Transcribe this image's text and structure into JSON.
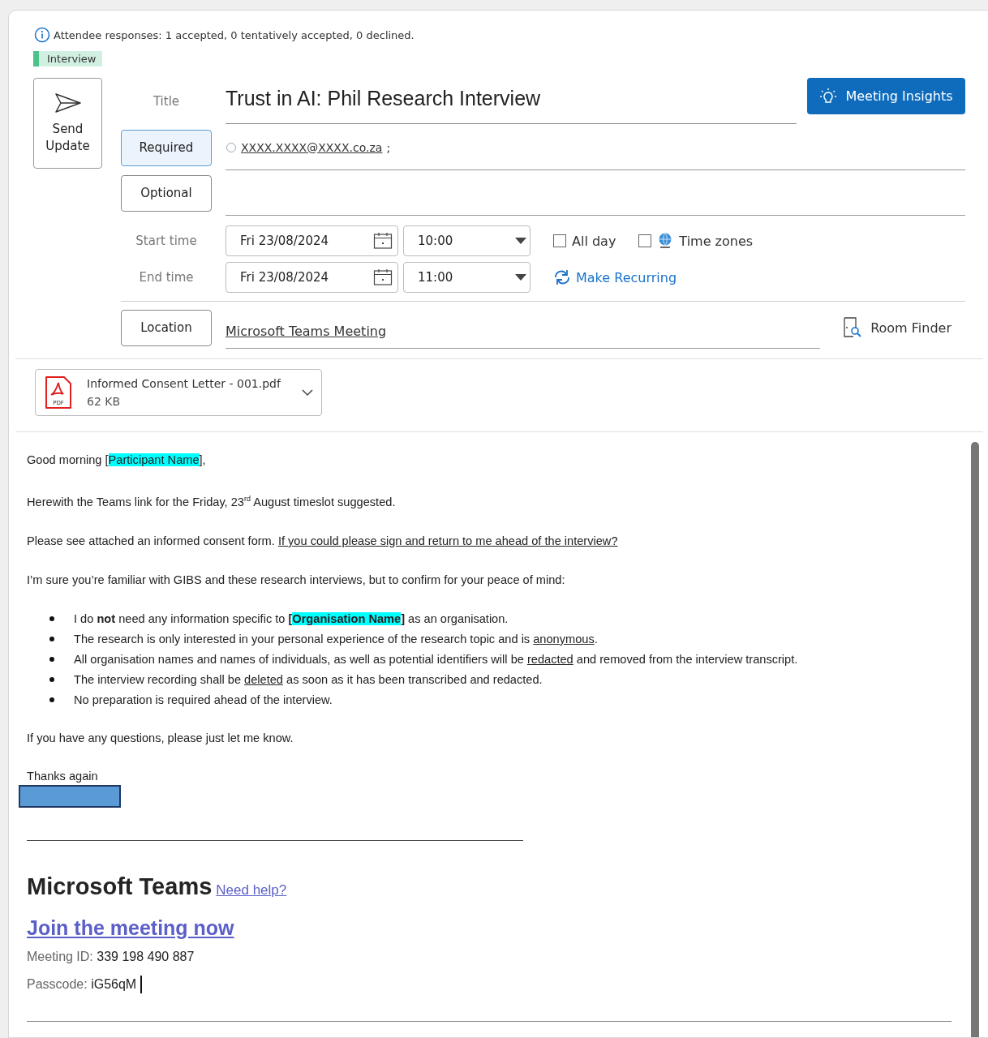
{
  "info_bar": {
    "text": "Attendee responses: 1 accepted, 0 tentatively accepted, 0 declined."
  },
  "category": {
    "label": "Interview",
    "color": "#4cc38a"
  },
  "send_button": {
    "label": "Send Update"
  },
  "insights_button": {
    "label": "Meeting Insights"
  },
  "title": {
    "label": "Title",
    "value": "Trust in AI: Phil Research Interview"
  },
  "required": {
    "label": "Required",
    "selected": true,
    "attendees": [
      {
        "address": "XXXX.XXXX@XXXX.co.za",
        "separator": ";"
      }
    ]
  },
  "optional": {
    "label": "Optional",
    "selected": false
  },
  "times": [
    {
      "label": "Start time",
      "date": "Fri 23/08/2024",
      "time": "10:00"
    },
    {
      "label": "End time",
      "date": "Fri 23/08/2024",
      "time": "11:00"
    }
  ],
  "all_day": {
    "label": "All day",
    "checked": false
  },
  "time_zones": {
    "label": "Time zones",
    "checked": false
  },
  "recurring": {
    "label": "Make Recurring"
  },
  "location": {
    "button": "Location",
    "value": "Microsoft Teams Meeting",
    "room_finder": "Room Finder"
  },
  "attachments": [
    {
      "name": "Informed Consent Letter - 001.pdf",
      "size": "62 KB",
      "file_type": "PDF"
    }
  ],
  "body": [
    {
      "kind": "paragraph",
      "runs": [
        {
          "text": "Good morning ["
        },
        {
          "text": "Participant Name",
          "highlight": true
        },
        {
          "text": "],"
        }
      ]
    },
    {
      "kind": "paragraph",
      "runs": [
        {
          "text": "Herewith the Teams link for the Friday, 23$^{rd}$ August timeslot suggested."
        }
      ]
    },
    {
      "kind": "paragraph",
      "runs": [
        {
          "text": "Please see attached an informed consent form. "
        },
        {
          "text": "If you could please sign and return to me ahead of the interview?",
          "underline": true
        }
      ]
    },
    {
      "kind": "paragraph",
      "runs": [
        {
          "text": "I’m sure you’re familiar with GIBS and these research interviews, but to confirm for your peace of mind:"
        }
      ]
    },
    {
      "kind": "list",
      "items": [
        {
          "runs": [
            {
              "text": "I do **not** need any information specific to **[**"
            },
            {
              "text": "**Organisation Name**",
              "highlight": true
            },
            {
              "text": "**]** as an organisation."
            }
          ]
        },
        {
          "runs": [
            {
              "text": "The research is only interested in your personal experience of the research topic and is "
            },
            {
              "text": "anonymous",
              "underline": true
            },
            {
              "text": "."
            }
          ]
        },
        {
          "runs": [
            {
              "text": "All organisation names and names of individuals, as well as potential identifiers will be "
            },
            {
              "text": "redacted",
              "underline": true
            },
            {
              "text": " and removed from the interview transcript."
            }
          ]
        },
        {
          "runs": [
            {
              "text": "The interview recording shall be "
            },
            {
              "text": "deleted",
              "underline": true
            },
            {
              "text": " as soon as it has been transcribed and redacted."
            }
          ]
        },
        {
          "runs": [
            {
              "text": "No preparation is required ahead of the interview."
            }
          ]
        }
      ]
    },
    {
      "kind": "paragraph",
      "runs": [
        {
          "text": "If you have any questions, please just let me know."
        }
      ]
    },
    {
      "kind": "closing",
      "text": "Thanks again"
    },
    {
      "kind": "redaction"
    },
    {
      "kind": "rule"
    },
    {
      "kind": "teams",
      "title": "Microsoft Teams",
      "help": "Need help?"
    },
    {
      "kind": "join",
      "text": "Join the meeting now"
    },
    {
      "kind": "detail",
      "label": "Meeting ID:",
      "value": "339 198 490 887",
      "cursor": false
    },
    {
      "kind": "detail",
      "label": "Passcode:",
      "value": "iG56qM",
      "cursor": true
    },
    {
      "kind": "rule"
    }
  ]
}
